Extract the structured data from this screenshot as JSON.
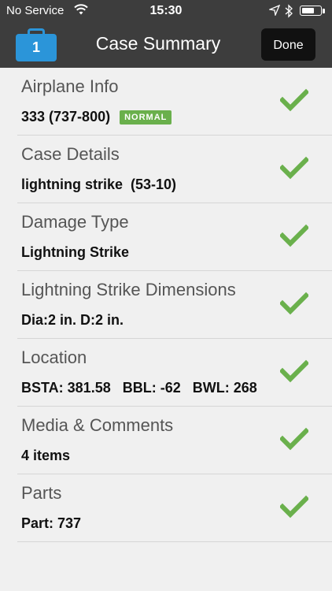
{
  "status_bar": {
    "carrier": "No Service",
    "time": "15:30",
    "battery_level": 0.7
  },
  "nav": {
    "case_number": "1",
    "title": "Case Summary",
    "done_label": "Done"
  },
  "colors": {
    "accent": "#2b95d9",
    "check": "#6ab04c",
    "bar": "#3d3d3d"
  },
  "rows": [
    {
      "title": "Airplane Info",
      "value": "333 (737-800)",
      "badge": "NORMAL",
      "icon": "check-icon"
    },
    {
      "title": "Case Details",
      "value": "lightning strike  (53-10)",
      "icon": "check-icon"
    },
    {
      "title": "Damage Type",
      "value": "Lightning Strike",
      "icon": "check-icon"
    },
    {
      "title": "Lightning Strike Dimensions",
      "value": "Dia:2 in. D:2 in.",
      "icon": "check-icon"
    },
    {
      "title": "Location",
      "value": "BSTA: 381.58   BBL: -62   BWL: 268",
      "icon": "check-icon"
    },
    {
      "title": "Media & Comments",
      "value": "4 items",
      "icon": "check-icon"
    },
    {
      "title": "Parts",
      "value": "Part: 737",
      "icon": "check-icon"
    }
  ]
}
